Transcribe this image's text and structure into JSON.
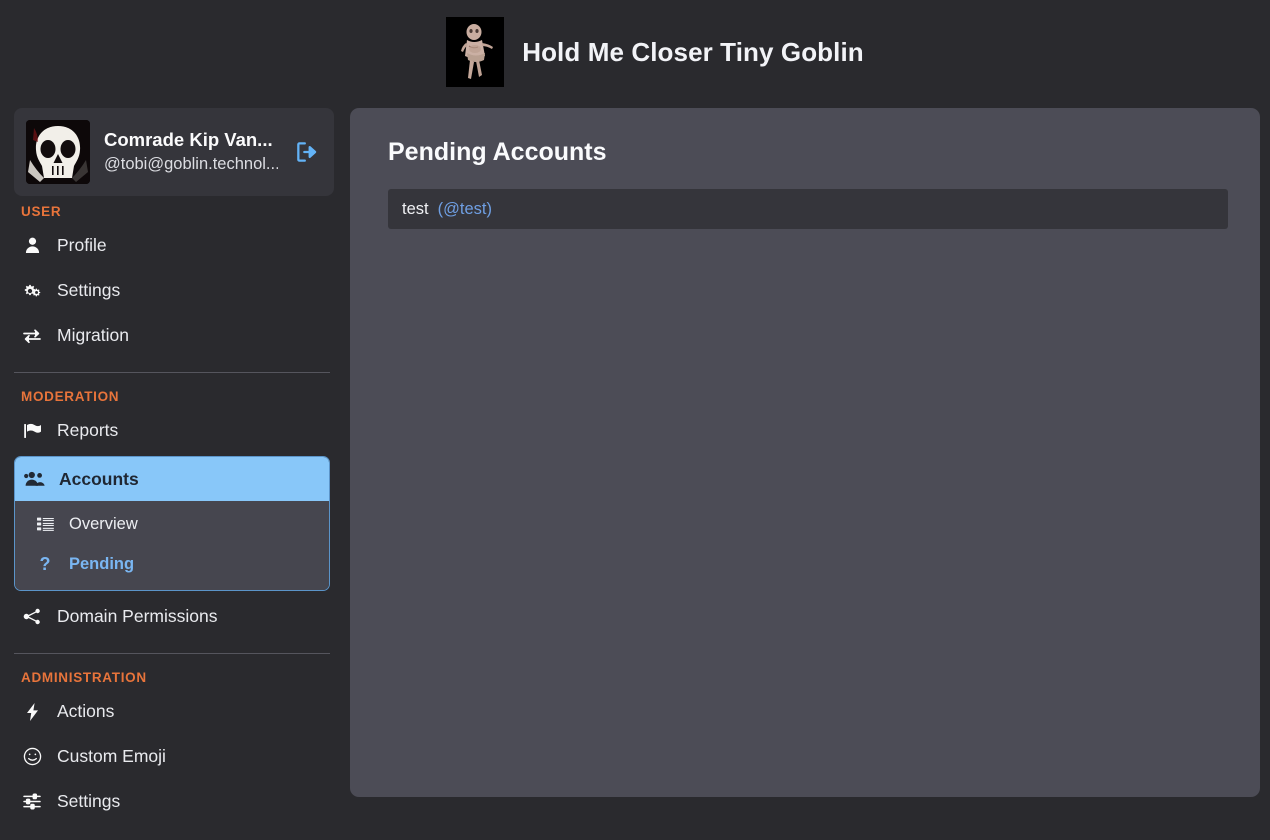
{
  "header": {
    "title": "Hold Me Closer Tiny Goblin",
    "logo_icon": "goblin-avatar-image"
  },
  "sidebar": {
    "profile": {
      "name": "Comrade Kip Van...",
      "handle": "@tobi@goblin.technol...",
      "avatar_icon": "skull-avatar-image",
      "logout_icon": "sign-out-icon"
    },
    "sections": [
      {
        "heading": "USER",
        "items": [
          {
            "label": "Profile",
            "icon": "user-icon"
          },
          {
            "label": "Settings",
            "icon": "cogs-icon"
          },
          {
            "label": "Migration",
            "icon": "exchange-arrows-icon"
          }
        ]
      },
      {
        "heading": "MODERATION",
        "items": [
          {
            "label": "Reports",
            "icon": "flag-icon"
          }
        ],
        "active_group": {
          "label": "Accounts",
          "icon": "users-icon",
          "submenu": [
            {
              "label": "Overview",
              "icon": "list-icon",
              "current": false
            },
            {
              "label": "Pending",
              "icon": "question-mark-icon",
              "current": true
            }
          ]
        },
        "items_after": [
          {
            "label": "Domain Permissions",
            "icon": "share-nodes-icon"
          }
        ]
      },
      {
        "heading": "ADMINISTRATION",
        "items": [
          {
            "label": "Actions",
            "icon": "bolt-icon"
          },
          {
            "label": "Custom Emoji",
            "icon": "smile-icon"
          },
          {
            "label": "Settings",
            "icon": "sliders-icon"
          }
        ]
      }
    ]
  },
  "main": {
    "panel_title": "Pending Accounts",
    "accounts": [
      {
        "name": "test",
        "handle": "(@test)"
      }
    ]
  },
  "colors": {
    "page_bg": "#2a2a2e",
    "panel_bg": "#4c4c56",
    "card_bg": "#35353b",
    "accent_orange": "#e8743b",
    "accent_blue": "#88c7f9",
    "link_blue": "#6f9fe3"
  }
}
